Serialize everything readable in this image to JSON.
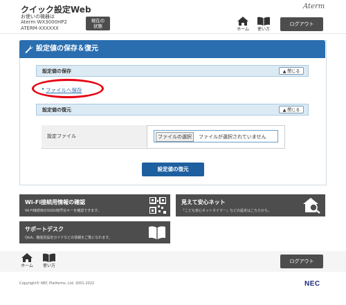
{
  "header": {
    "title": "クイック設定Web",
    "device_label": "お使いの機器は",
    "device_model": "Aterm WX3000HP2",
    "device_id": "ATERM-XXXXXX",
    "status_button": [
      "現在の",
      "状態"
    ],
    "brand": "Aterm",
    "home_label": "ホーム",
    "manual_label": "使い方",
    "logout_label": "ログアウト"
  },
  "main": {
    "section_title": "設定値の保存＆復元",
    "save_section": {
      "title": "設定値の保存",
      "close_label": "閉じる",
      "link": "ファイルへ保存"
    },
    "restore_section": {
      "title": "設定値の復元",
      "close_label": "閉じる"
    },
    "file_row": {
      "label": "設定ファイル",
      "choose_button": "ファイルの選択",
      "status": "ファイルが選択されていません"
    },
    "restore_button": "設定値の復元"
  },
  "cards": {
    "wifi": {
      "title": "Wi-Fi接続用情報の確認",
      "desc": "Wi-Fi接続用のSSID/暗号化キーを確認できます。"
    },
    "safety": {
      "title": "見えて安心ネット",
      "desc": "「こども安心ネットタイマー」などの設定はこちらから。"
    },
    "support": {
      "title": "サポートデスク",
      "desc": "Q&A、機能別設定ガイドなどの情報をご覧になれます。"
    }
  },
  "footer": {
    "home_label": "ホーム",
    "manual_label": "使い方",
    "logout_label": "ログアウト",
    "copyright": "Copyright© NEC Platforms, Ltd. 2001-2022",
    "logo": "NEC"
  },
  "colors": {
    "accent": "#2a6eb0",
    "dark_button": "#4d4d4d",
    "highlight": "#e60012"
  }
}
